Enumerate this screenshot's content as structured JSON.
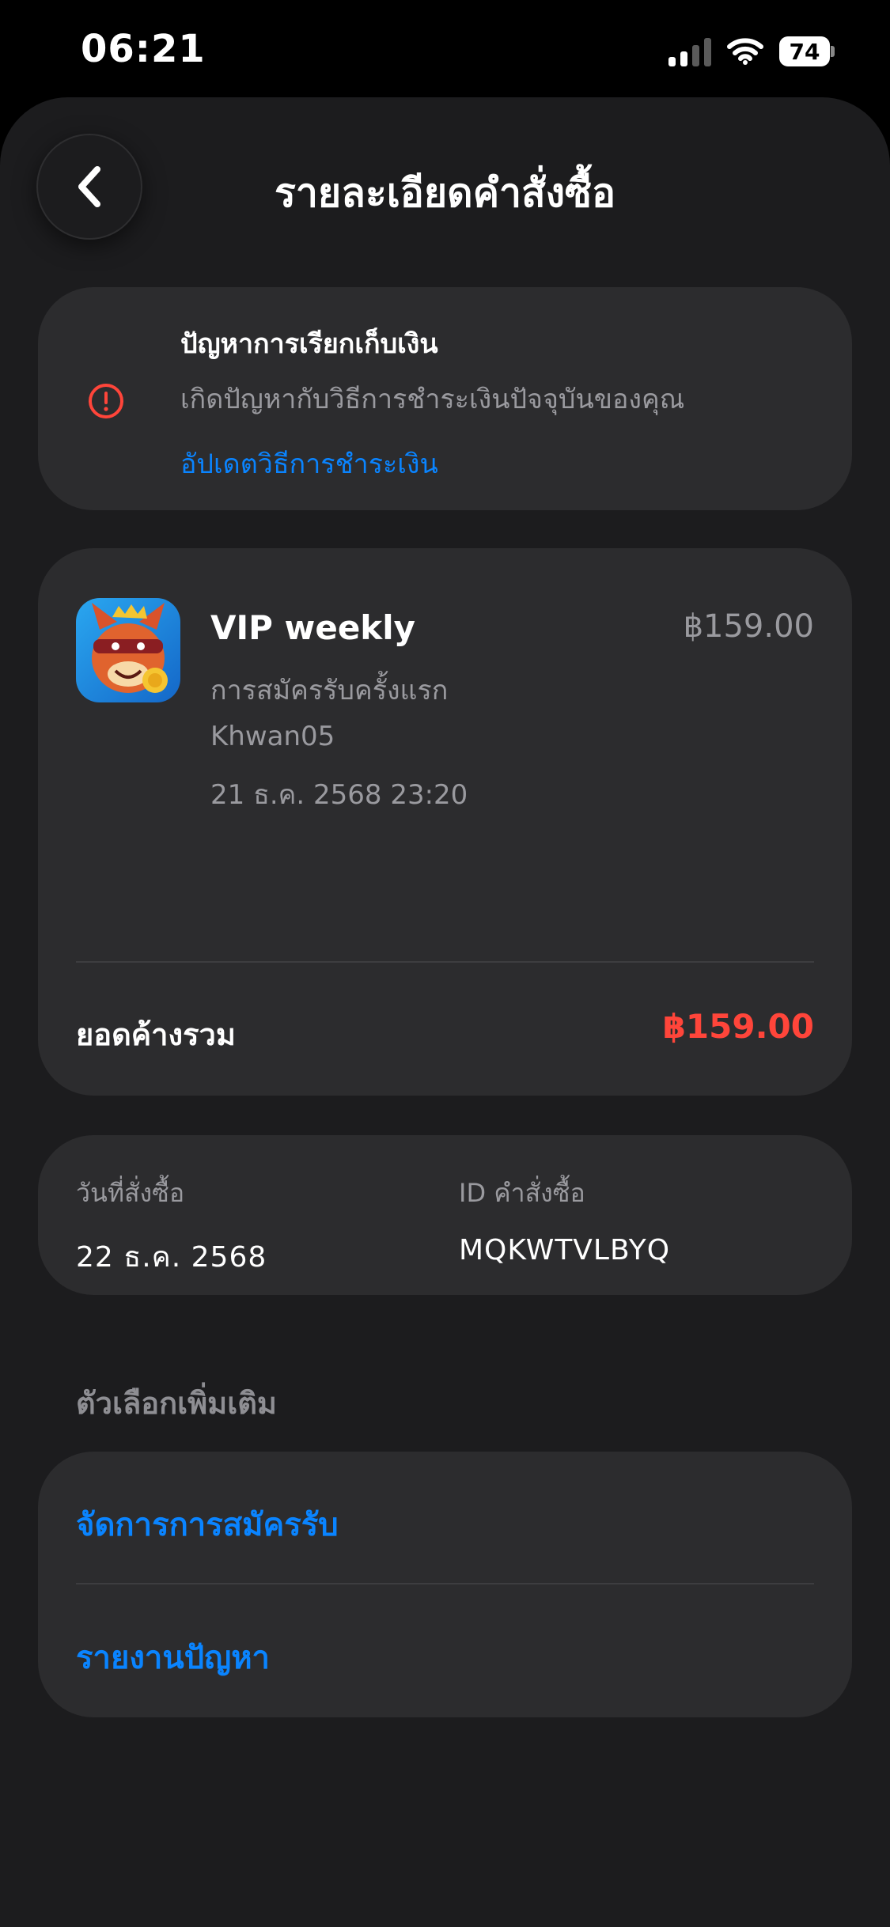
{
  "status_bar": {
    "time": "06:21",
    "battery": "74"
  },
  "nav": {
    "title": "รายละเอียดคำสั่งซื้อ"
  },
  "billing_issue": {
    "title": "ปัญหาการเรียกเก็บเงิน",
    "description": "เกิดปัญหากับวิธีการชำระเงินปัจจุบันของคุณ",
    "link": "อัปเดตวิธีการชำระเงิน"
  },
  "order": {
    "product_name": "VIP weekly",
    "price": "฿159.00",
    "subscription_type": "การสมัครรับครั้งแรก",
    "account": "Khwan05",
    "datetime": "21 ธ.ค. 2568 23:20",
    "total_label": "ยอดค้างรวม",
    "total_value": "฿159.00"
  },
  "info": {
    "order_date_label": "วันที่สั่งซื้อ",
    "order_date": "22 ธ.ค. 2568",
    "order_id_label": "ID คำสั่งซื้อ",
    "order_id": "MQKWTVLBYQ"
  },
  "more_options": {
    "header": "ตัวเลือกเพิ่มเติม",
    "items": [
      {
        "label": "จัดการการสมัครรับ"
      },
      {
        "label": "รายงานปัญหา"
      }
    ]
  },
  "colors": {
    "accent": "#0a84ff",
    "alert": "#ff453a",
    "card": "#2c2c2e",
    "sheet": "#1c1c1e"
  }
}
